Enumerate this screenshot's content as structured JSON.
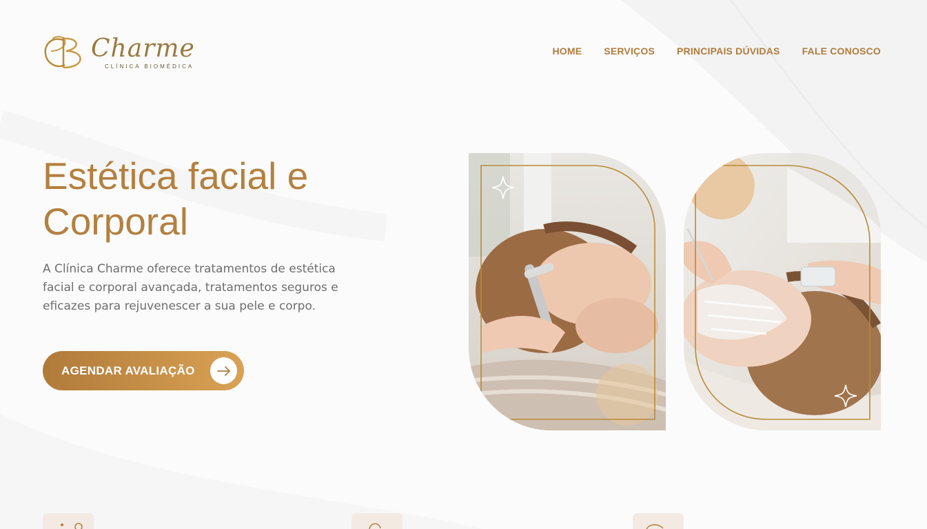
{
  "brand": {
    "monogram": "CB",
    "name": "Charme",
    "tagline": "CLÍNICA BIOMÉDICA"
  },
  "nav": {
    "items": [
      "HOME",
      "SERVIÇOS",
      "PRINCIPAIS DÚVIDAS",
      "FALE CONOSCO"
    ]
  },
  "hero": {
    "title_line1": "Estética facial e",
    "title_line2": "Corporal",
    "description": "A Clínica Charme oferece tratamentos de estética facial e corporal avançada, tratamentos seguros e eficazes para rejuvenescer a sua pele e corpo.",
    "cta_label": "AGENDAR AVALIAÇÃO"
  },
  "images": {
    "left": "woman-facial-microcurrent-treatment",
    "right": "woman-facial-mask-application"
  },
  "icons": [
    "sparkle-icon",
    "arrow-right-icon",
    "feature-icon"
  ],
  "colors": {
    "accent": "#b4803f",
    "nav": "#b07c3e",
    "button_start": "#b07a3a",
    "button_end": "#d9a254",
    "text": "#6e6e6e"
  }
}
